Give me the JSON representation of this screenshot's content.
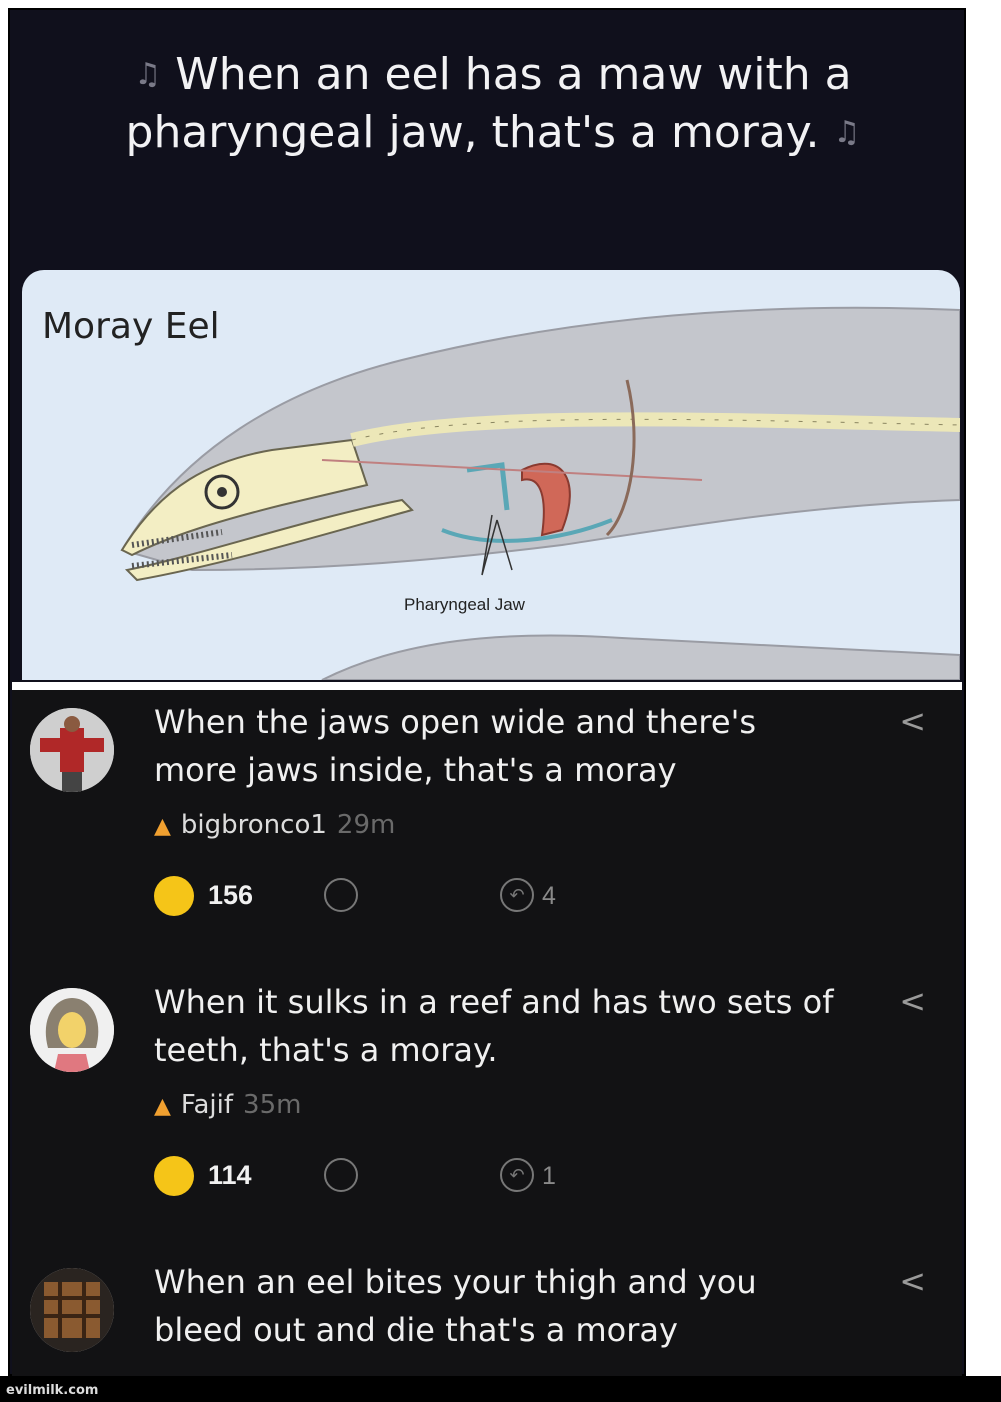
{
  "meme": {
    "title_line1": "When an eel has a maw with a",
    "title_line2": "pharyngeal jaw, that's a moray.",
    "music_note_icon": "music-note-icon"
  },
  "diagram": {
    "title": "Moray Eel",
    "jaw_label": "Pharyngeal Jaw"
  },
  "comments": [
    {
      "text": "When the jaws open wide and there's more jaws inside, that's a moray",
      "username": "bigbronco1",
      "time": "29m",
      "likes": "156",
      "replies": "4",
      "share": "<"
    },
    {
      "text": "When it sulks in a reef and has two sets of teeth, that's a moray.",
      "username": "Fajif",
      "time": "35m",
      "likes": "114",
      "replies": "1",
      "share": "<"
    },
    {
      "text": "When an eel bites your thigh and you bleed out and die that's a moray",
      "share": "<"
    }
  ],
  "watermark": "evilmilk.com",
  "colors": {
    "background": "#10101c",
    "diagram_bg": "#dfeaf6",
    "like_emoji": "#f5c518",
    "flame": "#f0a030"
  }
}
